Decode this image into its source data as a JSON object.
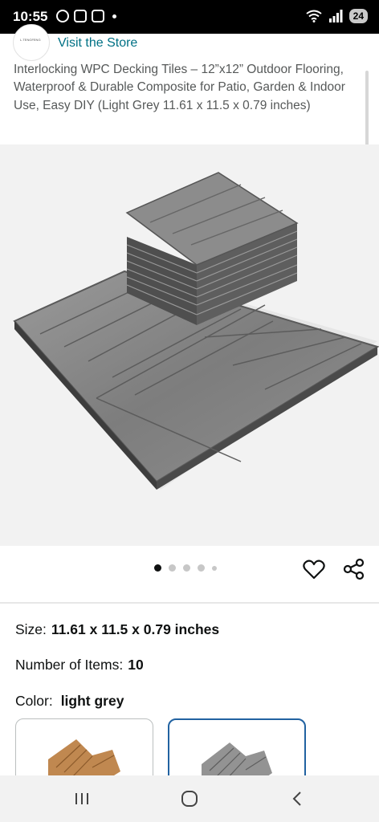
{
  "status_bar": {
    "time": "10:55",
    "battery": "24",
    "left_icons": [
      "whatsapp-icon",
      "screenshot-icon",
      "instagram-icon",
      "notification-dot-icon"
    ],
    "right_icons": [
      "wifi-icon",
      "signal-icon",
      "battery-icon"
    ]
  },
  "store": {
    "visit_label": "Visit the Store",
    "logo_text": "L.TENGFENG"
  },
  "product": {
    "title": "Interlocking WPC Decking Tiles – 12”x12” Outdoor Flooring, Waterproof & Durable Composite for Patio, Garden & Indoor Use, Easy DIY (Light Grey 11.61 x 11.5 x 0.79 inches)",
    "image_icon": "product-photo",
    "carousel": {
      "total": 5,
      "active_index": 0
    }
  },
  "actions": {
    "favorite_icon": "heart-icon",
    "share_icon": "share-icon"
  },
  "attributes": {
    "size_label": "Size:",
    "size_value": "11.61 x 11.5 x 0.79 inches",
    "items_label": "Number of Items:",
    "items_value": "10",
    "color_label": "Color:",
    "color_value": "light grey"
  },
  "swatches": [
    {
      "name": "teak",
      "color": "#b57a45",
      "selected": false
    },
    {
      "name": "light grey",
      "color": "#8a8a8a",
      "selected": true
    }
  ],
  "colors": {
    "link": "#007185",
    "selected_border": "#2162a1",
    "title_gray": "#565959"
  },
  "nav": [
    "recent-apps-icon",
    "home-icon",
    "back-icon"
  ]
}
